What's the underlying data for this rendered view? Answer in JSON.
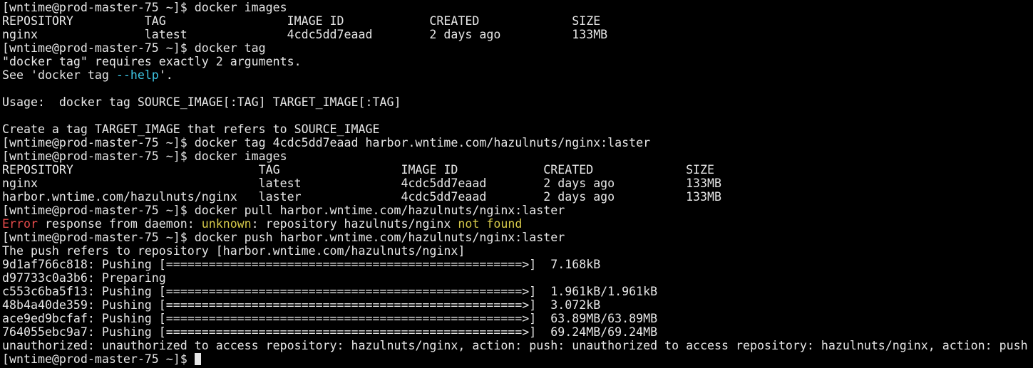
{
  "colors": {
    "background": "#000000",
    "foreground": "#e6e6e6",
    "error": "#e54b4b",
    "warning": "#d6c94a",
    "flag": "#3ec8e6"
  },
  "lines": [
    [
      {
        "t": "[wntime@prod-master-75 ~]$ docker images"
      }
    ],
    [
      {
        "t": "REPOSITORY          TAG                 IMAGE ID            CREATED             SIZE"
      }
    ],
    [
      {
        "t": "nginx               latest              4cdc5dd7eaad        2 days ago          133MB"
      }
    ],
    [
      {
        "t": "[wntime@prod-master-75 ~]$ docker tag"
      }
    ],
    [
      {
        "t": "\"docker tag\" requires exactly 2 arguments."
      }
    ],
    [
      {
        "t": "See 'docker tag "
      },
      {
        "t": "--help",
        "c": "flag"
      },
      {
        "t": "'."
      }
    ],
    [
      {
        "t": ""
      }
    ],
    [
      {
        "t": "Usage:  docker tag SOURCE_IMAGE[:TAG] TARGET_IMAGE[:TAG]"
      }
    ],
    [
      {
        "t": ""
      }
    ],
    [
      {
        "t": "Create a tag TARGET_IMAGE that refers to SOURCE_IMAGE"
      }
    ],
    [
      {
        "t": "[wntime@prod-master-75 ~]$ docker tag 4cdc5dd7eaad harbor.wntime.com/hazulnuts/nginx:laster"
      }
    ],
    [
      {
        "t": "[wntime@prod-master-75 ~]$ docker images"
      }
    ],
    [
      {
        "t": "REPOSITORY                          TAG                 IMAGE ID            CREATED             SIZE"
      }
    ],
    [
      {
        "t": "nginx                               latest              4cdc5dd7eaad        2 days ago          133MB"
      }
    ],
    [
      {
        "t": "harbor.wntime.com/hazulnuts/nginx   laster              4cdc5dd7eaad        2 days ago          133MB"
      }
    ],
    [
      {
        "t": "[wntime@prod-master-75 ~]$ docker pull harbor.wntime.com/hazulnuts/nginx:laster"
      }
    ],
    [
      {
        "t": "Error",
        "c": "error"
      },
      {
        "t": " response from daemon: "
      },
      {
        "t": "unknown",
        "c": "warning"
      },
      {
        "t": ": repository hazulnuts/nginx "
      },
      {
        "t": "not found",
        "c": "warning"
      }
    ],
    [
      {
        "t": "[wntime@prod-master-75 ~]$ docker push harbor.wntime.com/hazulnuts/nginx:laster"
      }
    ],
    [
      {
        "t": "The push refers to repository [harbor.wntime.com/hazulnuts/nginx]"
      }
    ],
    [
      {
        "t": "9d1af766c818: Pushing [==================================================>]  7.168kB"
      }
    ],
    [
      {
        "t": "d97733c0a3b6: Preparing"
      }
    ],
    [
      {
        "t": "c553c6ba5f13: Pushing [==================================================>]  1.961kB/1.961kB"
      }
    ],
    [
      {
        "t": "48b4a40de359: Pushing [==================================================>]  3.072kB"
      }
    ],
    [
      {
        "t": "ace9ed9bcfaf: Pushing [==================================================>]  63.89MB/63.89MB"
      }
    ],
    [
      {
        "t": "764055ebc9a7: Pushing [==================================================>]  69.24MB/69.24MB"
      }
    ],
    [
      {
        "t": "unauthorized: unauthorized to access repository: hazulnuts/nginx, action: push: unauthorized to access repository: hazulnuts/nginx, action: push"
      }
    ],
    [
      {
        "t": "[wntime@prod-master-75 ~]$ "
      }
    ]
  ],
  "cursor_line": 26
}
